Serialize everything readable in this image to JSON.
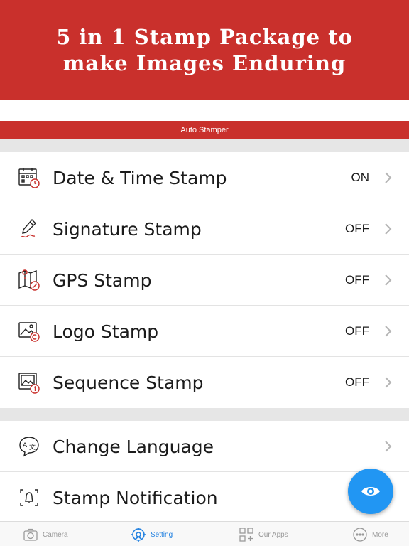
{
  "promo": {
    "line1": "5 in 1 Stamp Package to",
    "line2": "make Images Enduring"
  },
  "app": {
    "title": "Auto Stamper"
  },
  "stamps": [
    {
      "label": "Date & Time Stamp",
      "status": "ON",
      "icon": "calendar-clock-icon"
    },
    {
      "label": "Signature Stamp",
      "status": "OFF",
      "icon": "signature-pen-icon"
    },
    {
      "label": "GPS Stamp",
      "status": "OFF",
      "icon": "map-location-icon"
    },
    {
      "label": "Logo Stamp",
      "status": "OFF",
      "icon": "image-logo-icon"
    },
    {
      "label": "Sequence Stamp",
      "status": "OFF",
      "icon": "image-sequence-icon"
    }
  ],
  "settings": [
    {
      "label": "Change Language",
      "icon": "translate-icon"
    },
    {
      "label": "Stamp Notification",
      "icon": "notification-icon"
    }
  ],
  "fab": {
    "icon": "eye-icon"
  },
  "tabs": [
    {
      "label": "Camera",
      "icon": "camera-icon",
      "active": false
    },
    {
      "label": "Setting",
      "icon": "gear-icon",
      "active": true
    },
    {
      "label": "Our Apps",
      "icon": "apps-icon",
      "active": false
    },
    {
      "label": "More",
      "icon": "more-icon",
      "active": false
    }
  ],
  "colors": {
    "brand_red": "#c9302c",
    "accent_blue": "#2196f3",
    "tab_active": "#1e7fe0",
    "icon_red": "#c9302c"
  }
}
